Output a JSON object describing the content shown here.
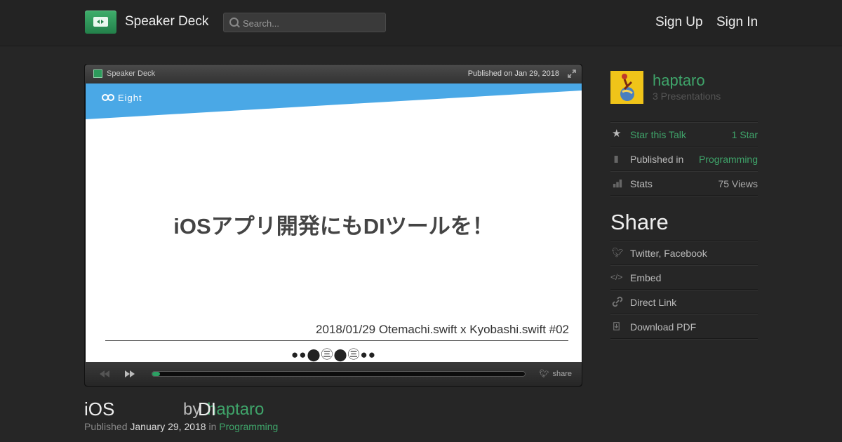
{
  "header": {
    "brand": "Speaker Deck",
    "search_placeholder": "Search...",
    "sign_up": "Sign Up",
    "sign_in": "Sign In"
  },
  "player": {
    "brand": "Speaker Deck",
    "published": "Published on Jan 29, 2018",
    "progress_percent": 2,
    "share_label": "share",
    "slide": {
      "brand": "Eight",
      "title": "iOSアプリ開発にもDIツールを！",
      "subtitle": "2018/01/29 Otemachi.swift x Kyobashi.swift #02",
      "dots": "●●⬤㊂⬤㊂●●"
    }
  },
  "talk": {
    "title": "iOS",
    "by": "by",
    "title_suffix": "DI",
    "author": "haptaro",
    "published_label": "Published",
    "published_date": "January 29, 2018",
    "in_label": "in",
    "category": "Programming"
  },
  "sidebar": {
    "author_name": "haptaro",
    "presentations": "3 Presentations",
    "star_label": "Star this Talk",
    "star_count": "1 Star",
    "published_in_label": "Published in",
    "published_in_value": "Programming",
    "stats_label": "Stats",
    "stats_value": "75 Views",
    "share_heading": "Share",
    "share_items": [
      "Twitter, Facebook",
      "Embed",
      "Direct Link",
      "Download PDF"
    ]
  },
  "colors": {
    "accent_green": "#3fa46a",
    "slide_blue": "#4aa8e6",
    "background": "#262626"
  }
}
